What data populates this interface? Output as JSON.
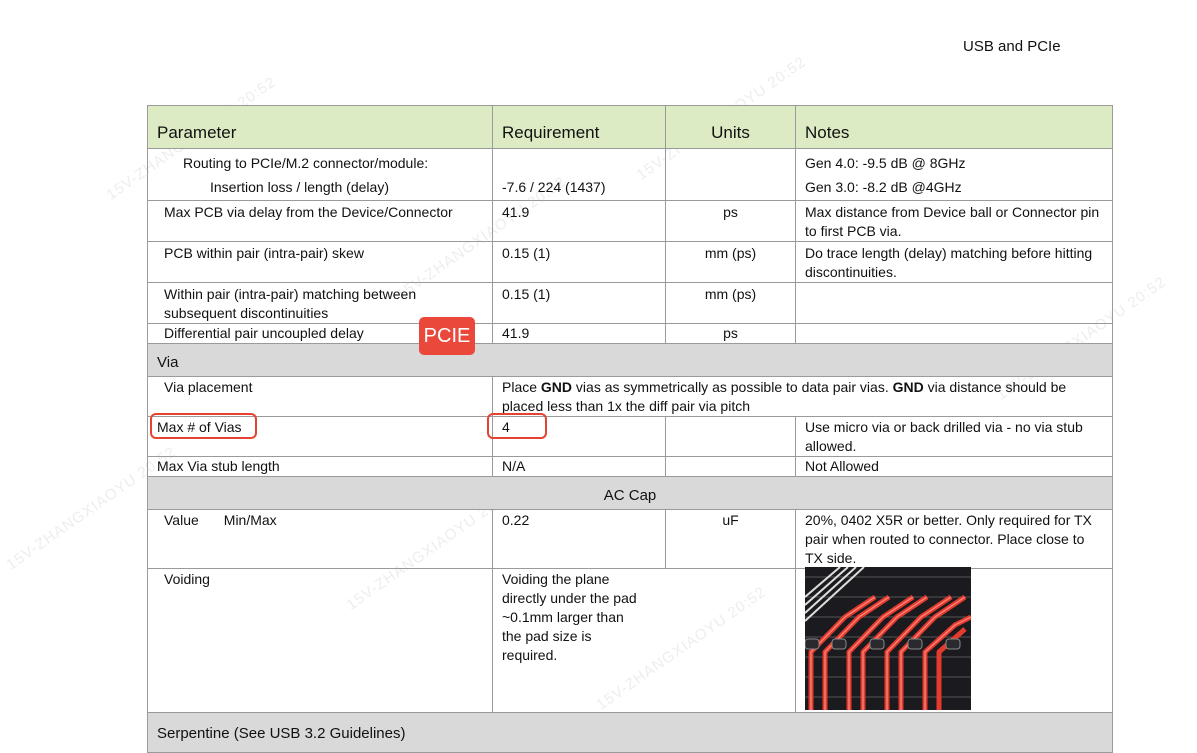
{
  "page_header": "USB and PCIe",
  "watermark": "15V-ZHANGXIAOYU 20:52",
  "tag_label": "PCIE",
  "table": {
    "headers": [
      "Parameter",
      "Requirement",
      "Units",
      "Notes"
    ],
    "routing": {
      "param_line1": "Routing to PCIe/M.2 connector/module:",
      "param_line2": "Insertion loss / length (delay)",
      "requirement": "-7.6 / 224 (1437)",
      "units": "",
      "notes_line1": "Gen 4.0:  -9.5 dB @ 8GHz",
      "notes_line2": "Gen 3.0:  -8.2 dB @4GHz"
    },
    "via_delay": {
      "param": "Max PCB via delay from the Device/Connector",
      "requirement": "41.9",
      "units": "ps",
      "notes": "Max distance from Device ball or Connector pin to first PCB via."
    },
    "intra_skew": {
      "param": "PCB within pair (intra-pair) skew",
      "requirement": "0.15 (1)",
      "units": "mm (ps)",
      "notes": "Do trace length (delay) matching before hitting discontinuities."
    },
    "intra_matching": {
      "param": "Within pair (intra-pair) matching between subsequent discontinuities",
      "requirement": "0.15 (1)",
      "units": "mm (ps)",
      "notes": ""
    },
    "uncoupled": {
      "param": "Differential pair uncoupled delay",
      "requirement": "41.9",
      "units": "ps",
      "notes": ""
    },
    "section_via": "Via",
    "via_placement": {
      "param": "Via placement",
      "req_part1": "Place ",
      "req_bold1": "GND",
      "req_part2": " vias as symmetrically as possible to data pair vias.  ",
      "req_bold2": "GND",
      "req_part3": " via distance should be placed less than 1x the diff pair via pitch"
    },
    "max_vias": {
      "param": "Max # of Vias",
      "requirement": "4",
      "units": "",
      "notes": "Use micro via or back drilled via - no via stub allowed."
    },
    "stub": {
      "param": "Max Via stub length",
      "requirement": "N/A",
      "units": "",
      "notes": "Not Allowed"
    },
    "section_ac": "AC Cap",
    "value_row": {
      "param1": "Value",
      "param2": "Min/Max",
      "requirement": "0.22",
      "units": "uF",
      "notes": "20%, 0402 X5R or better.  Only required for TX pair when routed to connector. Place close to TX side."
    },
    "voiding": {
      "param": "Voiding",
      "requirement": "Voiding the plane directly under the pad ~0.1mm larger than the pad size is required."
    },
    "section_serpentine": "Serpentine (See USB 3.2 Guidelines)"
  },
  "colors": {
    "header_bg": "#dcebc4",
    "section_bg": "#d9d9d9",
    "highlight": "#e5432f",
    "tag_bg": "#e9483b"
  }
}
